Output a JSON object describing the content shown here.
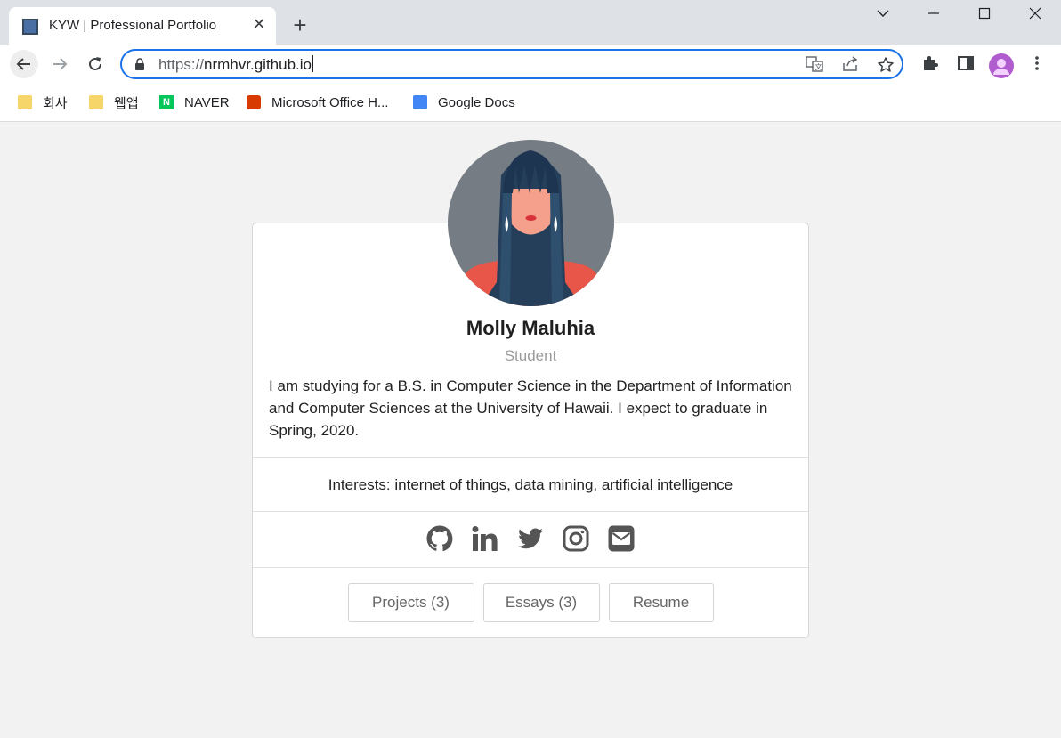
{
  "browser": {
    "tab_title": "KYW | Professional Portfolio",
    "tab_close": "✕",
    "new_tab": "+",
    "window": {
      "minimize": "—",
      "maximize": "☐",
      "close": "✕",
      "dropdown": "⌄"
    },
    "url_scheme": "https://",
    "url_host": "nrmhvr.github.io",
    "bookmarks": [
      {
        "label": "회사",
        "icon": "folder-icon"
      },
      {
        "label": "웹앱",
        "icon": "folder-icon"
      },
      {
        "label": "NAVER",
        "icon": "naver-icon",
        "icon_text": "N"
      },
      {
        "label": "Microsoft Office H...",
        "icon": "office-icon"
      },
      {
        "label": "Google Docs",
        "icon": "google-docs-icon"
      }
    ]
  },
  "profile": {
    "name": "Molly Maluhia",
    "role": "Student",
    "bio": "I am studying for a B.S. in Computer Science in the Department of Information and Computer Sciences at the University of Hawaii. I expect to graduate in Spring, 2020.",
    "interests": "Interests: internet of things, data mining, artificial intelligence",
    "social_icons": [
      "github-icon",
      "linkedin-icon",
      "twitter-icon",
      "instagram-icon",
      "email-icon"
    ],
    "buttons": {
      "projects": "Projects (3)",
      "essays": "Essays (3)",
      "resume": "Resume"
    }
  },
  "colors": {
    "accent": "#1a73e8",
    "page_bg": "#f2f2f2",
    "icon_gray": "#555555",
    "avatar_bg": "#757c84",
    "hair": "#253f5a",
    "jacket": "#e8564a"
  }
}
